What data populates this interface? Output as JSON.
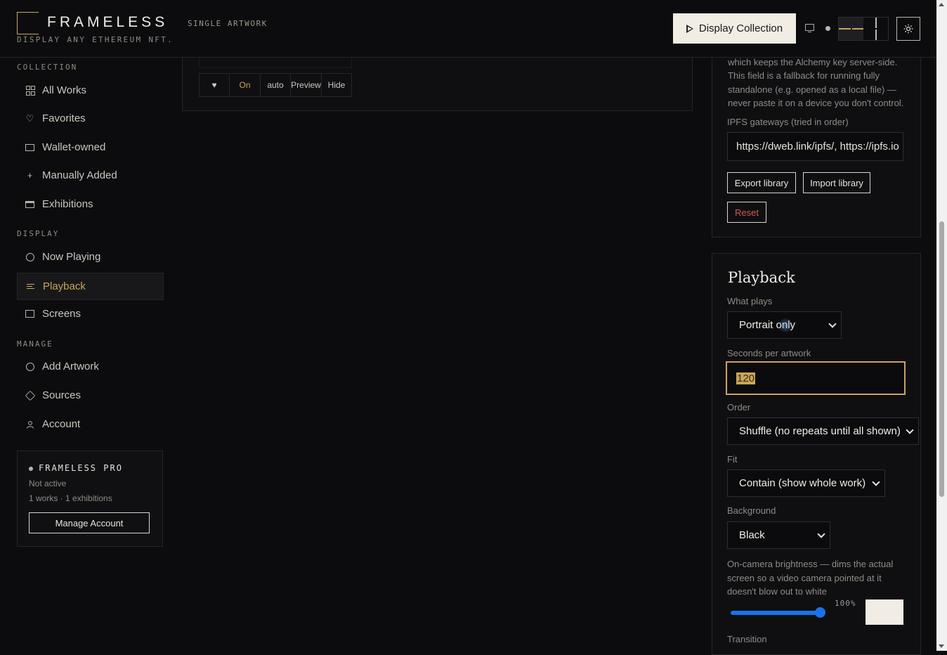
{
  "header": {
    "logo": "FRAMELESS",
    "mode": "SINGLE ARTWORK",
    "tagline": "DISPLAY ANY ETHEREUM NFT.",
    "display_button": "Display Collection"
  },
  "sidebar": {
    "collection_label": "COLLECTION",
    "collection_items": [
      "All Works",
      "Favorites",
      "Wallet-owned",
      "Manually Added",
      "Exhibitions"
    ],
    "display_label": "DISPLAY",
    "display_items": [
      "Now Playing",
      "Playback",
      "Screens"
    ],
    "manage_label": "MANAGE",
    "manage_items": [
      "Add Artwork",
      "Sources",
      "Account"
    ]
  },
  "pro": {
    "title": "FRAMELESS PRO",
    "status": "Not active",
    "stats": "1 works · 1 exhibitions",
    "button": "Manage Account"
  },
  "artwork_controls": {
    "favorite": "♥",
    "on": "On",
    "auto": "auto",
    "preview": "Preview",
    "hide": "Hide"
  },
  "sources_card": {
    "help": "which keeps the Alchemy key server-side. This field is a fallback for running fully standalone (e.g. opened as a local file) — never paste it on a device you don't control.",
    "ipfs_label": "IPFS gateways (tried in order)",
    "ipfs_value": "https://dweb.link/ipfs/, https://ipfs.io",
    "export": "Export library",
    "import": "Import library",
    "reset": "Reset"
  },
  "playback": {
    "title": "Playback",
    "what_label": "What plays",
    "what_value": "Portrait only",
    "seconds_label": "Seconds per artwork",
    "seconds_value": "120",
    "order_label": "Order",
    "order_value": "Shuffle (no repeats until all shown)",
    "fit_label": "Fit",
    "fit_value": "Contain (show whole work)",
    "background_label": "Background",
    "background_value": "Black",
    "brightness_label": "On-camera brightness — dims the actual screen so a video camera pointed at it doesn't blow out to white",
    "brightness_value": "100%",
    "transition_label": "Transition"
  },
  "colors": {
    "accent": "#c9a55c",
    "background": "#0c0c0e",
    "danger": "#d15a4a"
  }
}
